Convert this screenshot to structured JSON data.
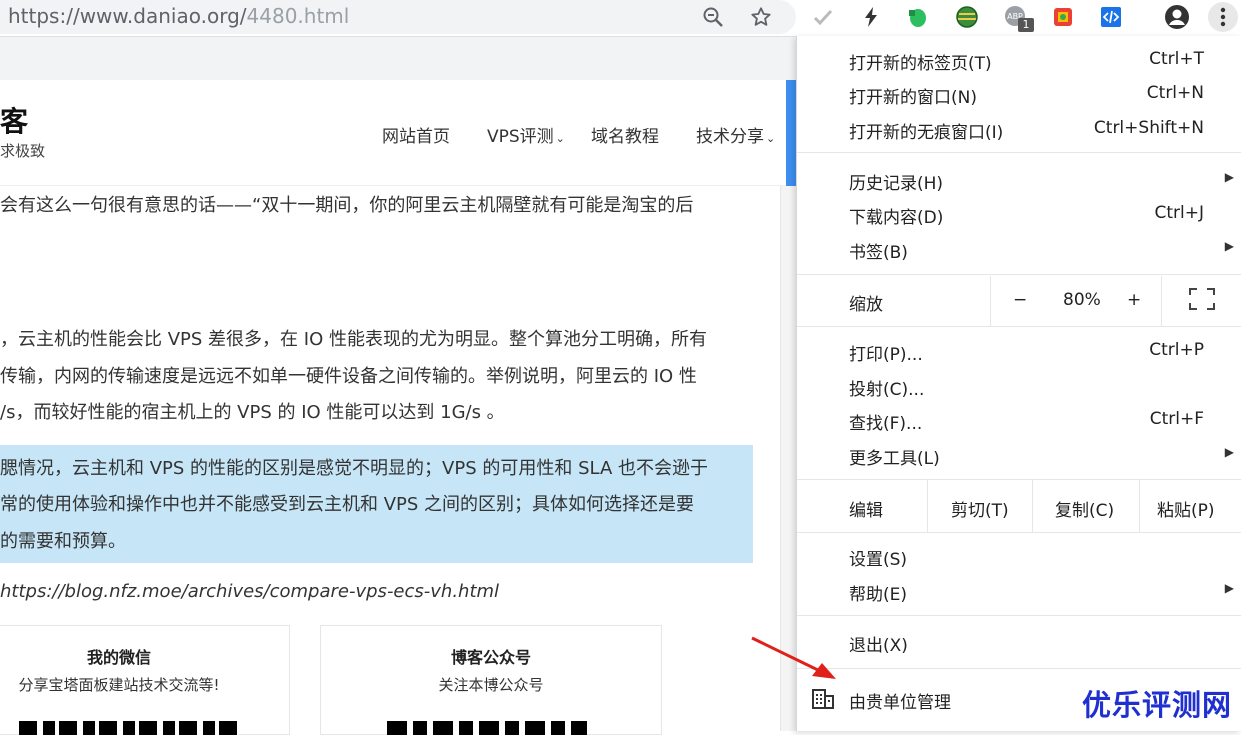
{
  "browser": {
    "url_host": "https://www.daniao.org/",
    "url_path": "4480.html",
    "extension_badge": "1"
  },
  "site": {
    "title_fragment": "客",
    "tagline_fragment": "求极致",
    "nav": [
      {
        "label": "网站首页"
      },
      {
        "label": "VPS评测"
      },
      {
        "label": "域名教程"
      },
      {
        "label": "技术分享"
      }
    ]
  },
  "article": {
    "line1": "会有这么一句很有意思的话——“双十一期间，你的阿里云主机隔壁就有可能是淘宝的后",
    "para2": [
      "，云主机的性能会比 VPS 差很多，在 IO 性能表现的尤为明显。整个算池分工明确，所有",
      "传输，内网的传输速度是远远不如单一硬件设备之间传输的。举例说明，阿里云的 IO 性",
      "/s，而较好性能的宿主机上的 VPS 的 IO 性能可以达到 1G/s 。"
    ],
    "quote": [
      "腮情况，云主机和 VPS 的性能的区别是感觉不明显的；VPS 的可用性和 SLA 也不会逊于",
      "常的使用体验和操作中也并不能感受到云主机和 VPS 之间的区别；具体如何选择还是要",
      "的需要和预算。"
    ],
    "source_link": "https://blog.nfz.moe/archives/compare-vps-ecs-vh.html",
    "cards": [
      {
        "title": "我的微信",
        "subtitle": "分享宝塔面板建站技术交流等!"
      },
      {
        "title": "博客公众号",
        "subtitle": "关注本博公众号"
      }
    ]
  },
  "menu": {
    "new_tab": {
      "label": "打开新的标签页(T)",
      "shortcut": "Ctrl+T"
    },
    "new_window": {
      "label": "打开新的窗口(N)",
      "shortcut": "Ctrl+N"
    },
    "incognito": {
      "label": "打开新的无痕窗口(I)",
      "shortcut": "Ctrl+Shift+N"
    },
    "history": {
      "label": "历史记录(H)"
    },
    "downloads": {
      "label": "下载内容(D)",
      "shortcut": "Ctrl+J"
    },
    "bookmarks": {
      "label": "书签(B)"
    },
    "zoom": {
      "label": "缩放",
      "minus": "−",
      "value": "80%",
      "plus": "+"
    },
    "print": {
      "label": "打印(P)...",
      "shortcut": "Ctrl+P"
    },
    "cast": {
      "label": "投射(C)..."
    },
    "find": {
      "label": "查找(F)...",
      "shortcut": "Ctrl+F"
    },
    "more_tools": {
      "label": "更多工具(L)"
    },
    "edit": {
      "label": "编辑",
      "cut": "剪切(T)",
      "copy": "复制(C)",
      "paste": "粘贴(P)"
    },
    "settings": {
      "label": "设置(S)"
    },
    "help": {
      "label": "帮助(E)"
    },
    "exit": {
      "label": "退出(X)"
    },
    "managed": {
      "label": "由贵单位管理"
    }
  },
  "watermark": "优乐评测网",
  "colors": {
    "accent_blue": "#3d8ef0",
    "quote_bg": "#c6e6f7",
    "arrow_red": "#e0201b",
    "watermark": "#1f2fd0"
  }
}
